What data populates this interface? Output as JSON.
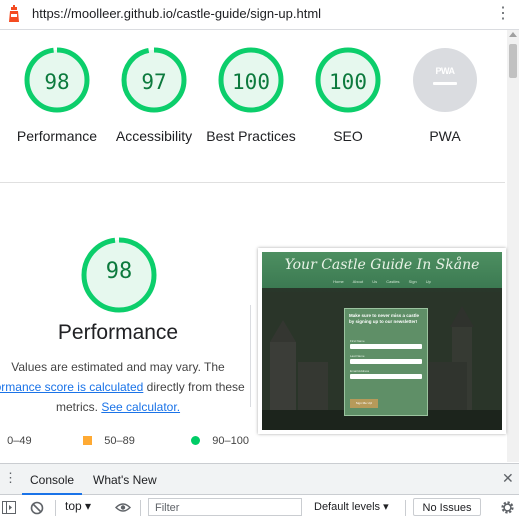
{
  "browser": {
    "url": "https://moolleer.github.io/castle-guide/sign-up.html",
    "menu_icon": "kebab-menu-icon"
  },
  "gauges": [
    {
      "score": "98",
      "label": "Performance",
      "value": 98
    },
    {
      "score": "97",
      "label": "Accessibility",
      "value": 97
    },
    {
      "score": "100",
      "label": "Best Practices",
      "value": 100
    },
    {
      "score": "100",
      "label": "SEO",
      "value": 100
    },
    {
      "score": "PWA",
      "label": "PWA",
      "value": null
    }
  ],
  "performance": {
    "score": "98",
    "value": 98,
    "title": "Performance",
    "desc_line1": "Values are estimated and may vary. The",
    "desc_link1": "formance score is calculated",
    "desc_line2_rest": " directly from these",
    "desc_line3_pre": "metrics. ",
    "desc_link2": "See calculator."
  },
  "screenshot": {
    "site_title": "Your Castle Guide In Skåne",
    "nav": "Home About Us Castles Sign Up",
    "form_title": "Make sure to never miss a castle by signing up to our newsletter!",
    "field1": "First Name",
    "field2": "Last Name",
    "field3": "Email Address",
    "button": "Sign Me Up!"
  },
  "legend": {
    "fail": "0–49",
    "average": "50–89",
    "pass": "90–100"
  },
  "colors": {
    "pass": "#0cce6b",
    "pass_text": "#0c7a3d",
    "pass_bg": "#e6f8ee",
    "average": "#ffaa33",
    "fail": "#c33300",
    "link": "#1a73e8"
  },
  "devtools": {
    "tab_console": "Console",
    "tab_whatsnew": "What's New",
    "context": "top",
    "filter_placeholder": "Filter",
    "levels": "Default levels",
    "issues": "No Issues"
  }
}
